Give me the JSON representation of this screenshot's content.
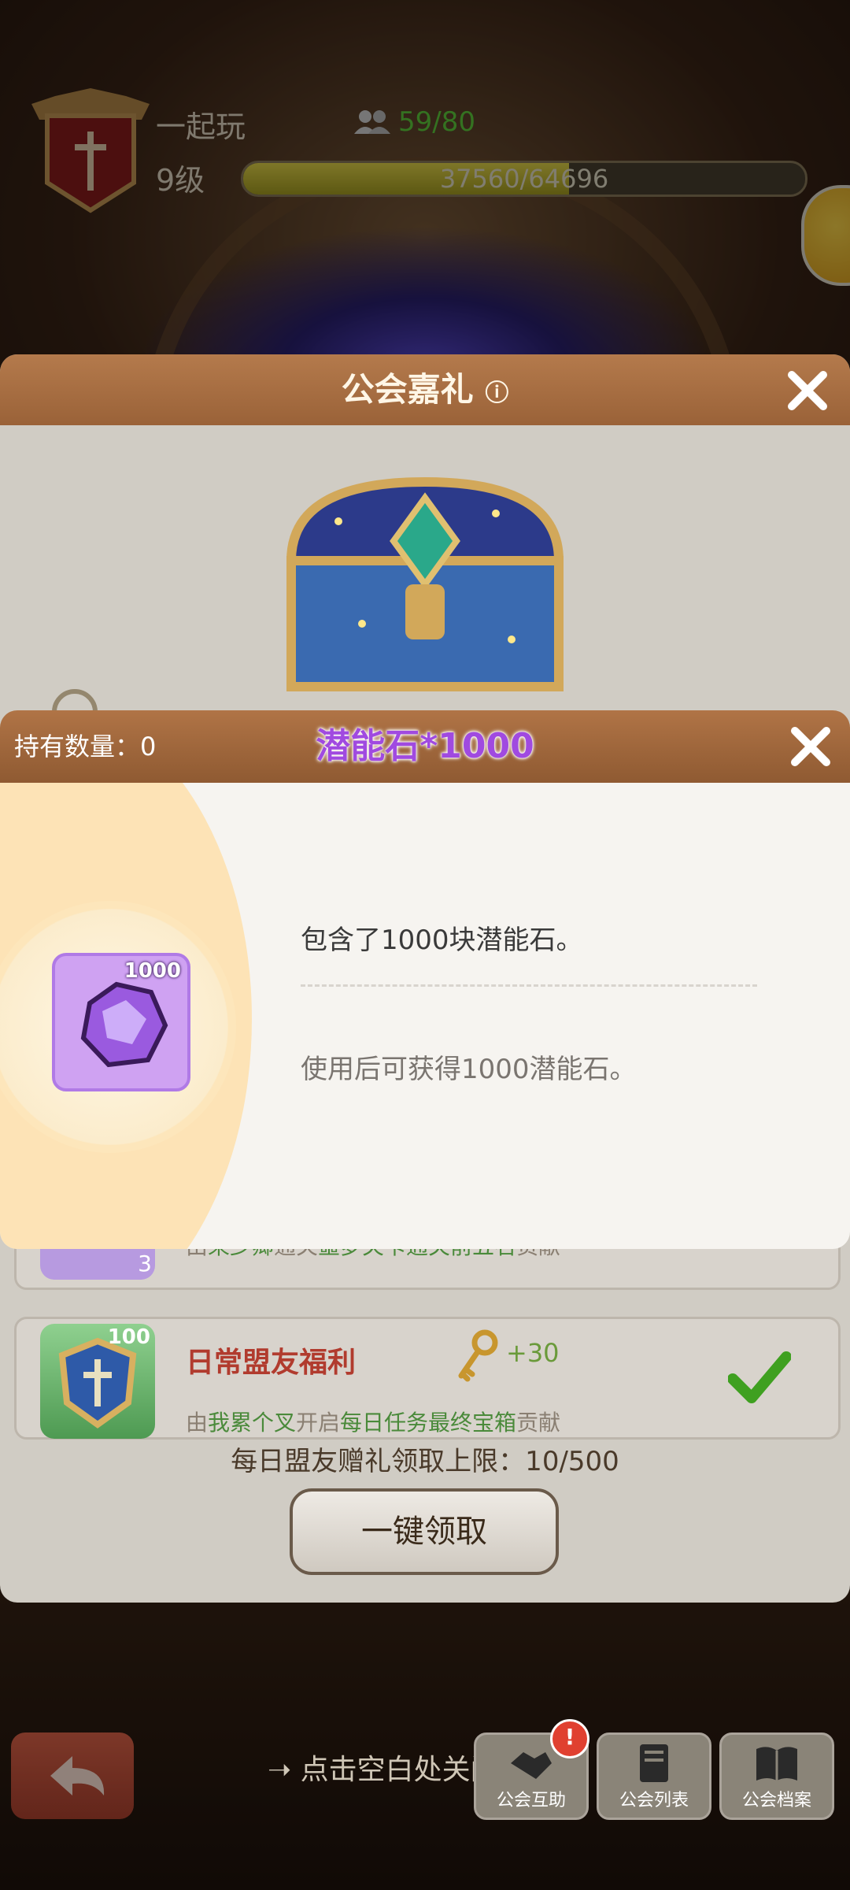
{
  "header": {
    "guild_name": "一起玩",
    "guild_level": "9级",
    "members": "59/80",
    "xp_text": "37560/64696",
    "xp_progress": 0.58
  },
  "gift_panel": {
    "title": "公会嘉礼",
    "rows": [
      {
        "item_count": "3",
        "desc_by": "由",
        "desc_name": "荣少卿",
        "desc_mid": "通关",
        "desc_stage": "噩梦关卡通关前五名",
        "desc_end": "贡献"
      },
      {
        "item_count": "100",
        "title": "日常盟友福利",
        "key_count": "+30",
        "desc_by": "由",
        "desc_name": "我累个叉",
        "desc_mid": "开启",
        "desc_stage": "每日任务最终宝箱",
        "desc_end": "贡献"
      }
    ],
    "daily_limit": "每日盟友赠礼领取上限：10/500",
    "claim_all_label": "一键领取"
  },
  "bottom": {
    "hint": "点击空白处关闭",
    "buttons": [
      {
        "label": "公会互助",
        "badge": "!"
      },
      {
        "label": "公会列表"
      },
      {
        "label": "公会档案"
      }
    ]
  },
  "item_popup": {
    "owned_label": "持有数量：0",
    "item_name": "潜能石*1000",
    "item_count": "1000",
    "description": "包含了1000块潜能石。",
    "effect": "使用后可获得1000潜能石。"
  },
  "colors": {
    "accent_purple": "#a04ae0",
    "member_green": "#5fcf3c",
    "title_red": "#b13b2e",
    "header_brown": "#9a6238"
  }
}
